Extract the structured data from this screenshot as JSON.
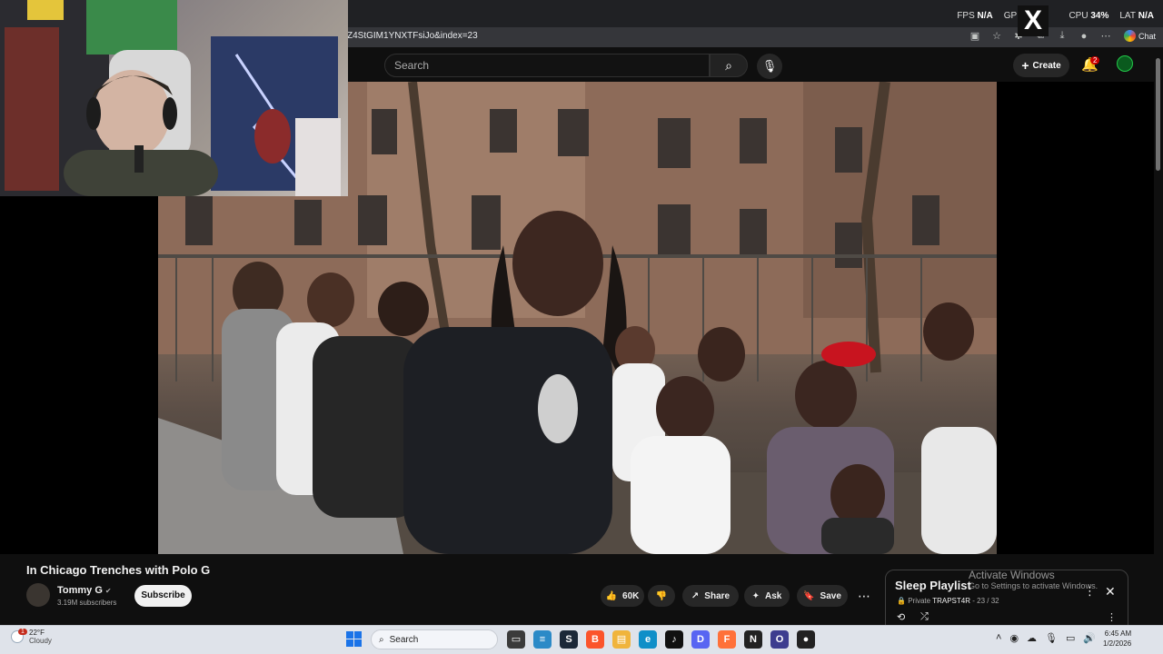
{
  "browser": {
    "url": "Z4StGIM1YNXTFsiJo&index=23",
    "chat_label": "Chat"
  },
  "stats": {
    "fps_label": "FPS",
    "fps_value": "N/A",
    "gpu_label": "GPU",
    "cpu_label": "CPU",
    "cpu_value": "34%",
    "lat_label": "LAT",
    "lat_value": "N/A"
  },
  "masthead": {
    "search_placeholder": "Search",
    "create_label": "Create",
    "notifications_count": "2"
  },
  "video": {
    "title": "In Chicago Trenches with Polo G",
    "channel_name": "Tommy G",
    "subscribers": "3.19M subscribers",
    "subscribe_label": "Subscribe",
    "likes": "60K",
    "share_label": "Share",
    "ask_label": "Ask",
    "save_label": "Save"
  },
  "playlist": {
    "title": "Sleep Playlist",
    "privacy": "Private",
    "owner": "TRAPST4R",
    "position": "23 / 32"
  },
  "watermark": {
    "line1": "Activate Windows",
    "line2": "Go to Settings to activate Windows."
  },
  "taskbar": {
    "weather_temp": "22°F",
    "weather_desc": "Cloudy",
    "weather_badge": "1",
    "search_label": "Search",
    "time": "6:45 AM",
    "date": "1/2/2026"
  }
}
